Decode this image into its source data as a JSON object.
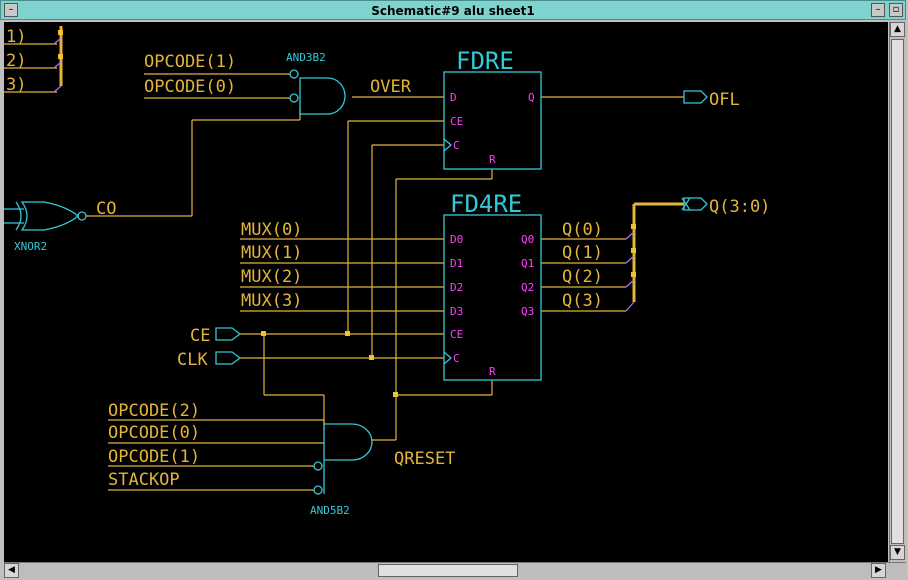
{
  "window": {
    "title": "Schematic#9 alu sheet1",
    "controls": {
      "minimize": "–",
      "maximize": "▫"
    }
  },
  "colors": {
    "canvas_bg": "#000000",
    "wire": "#e3b43a",
    "component": "#33c9d6",
    "pin_label": "#ff3fff",
    "junction": "#f2c12e"
  },
  "schematic": {
    "bus_top_left": [
      "1)",
      "2)",
      "3)"
    ],
    "and3b2": {
      "type": "AND3B2",
      "inputs": [
        "OPCODE(1)",
        "OPCODE(0)"
      ],
      "output": "OVER"
    },
    "xnor2": {
      "type": "XNOR2",
      "output": "CO"
    },
    "fdre": {
      "type": "FDRE",
      "pins_in": [
        "D",
        "CE",
        "C"
      ],
      "pin_out": "Q",
      "pin_reset": "R",
      "output_net": "OFL"
    },
    "fd4re": {
      "type": "FD4RE",
      "pins_in": [
        "D0",
        "D1",
        "D2",
        "D3",
        "CE",
        "C"
      ],
      "pins_out": [
        "Q0",
        "Q1",
        "Q2",
        "Q3"
      ],
      "pin_reset": "R",
      "input_nets": [
        "MUX(0)",
        "MUX(1)",
        "MUX(2)",
        "MUX(3)"
      ],
      "output_nets": [
        "Q(0)",
        "Q(1)",
        "Q(2)",
        "Q(3)"
      ],
      "output_bus": "Q(3:0)"
    },
    "ports": {
      "ce": "CE",
      "clk": "CLK"
    },
    "and5b2": {
      "type": "AND5B2",
      "inputs": [
        "OPCODE(2)",
        "OPCODE(0)",
        "OPCODE(1)",
        "STACKOP"
      ],
      "output": "QRESET"
    }
  },
  "scrollbars": {
    "up": "▲",
    "down": "▼",
    "left": "◀",
    "right": "▶"
  }
}
